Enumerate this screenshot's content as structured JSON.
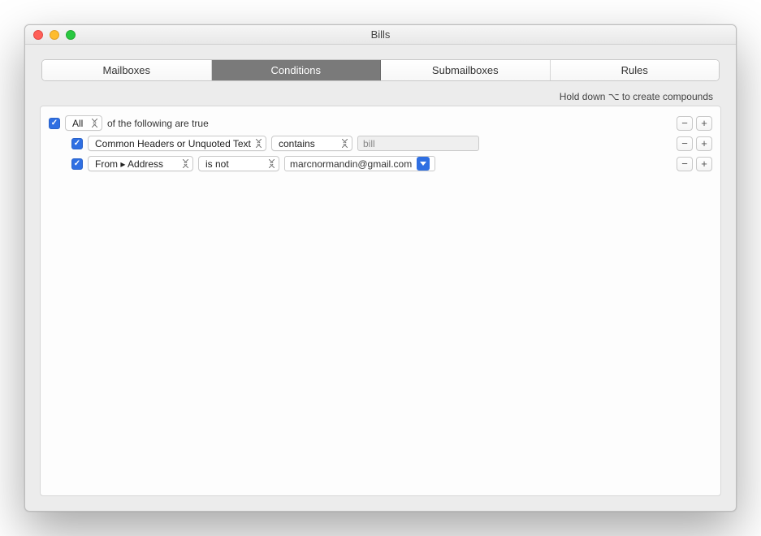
{
  "window": {
    "title": "Bills"
  },
  "tabs": {
    "mailboxes": "Mailboxes",
    "conditions": "Conditions",
    "submailboxes": "Submailboxes",
    "rules": "Rules",
    "active": "conditions"
  },
  "hint": "Hold down ⌥ to create compounds",
  "buttons": {
    "minus": "−",
    "plus": "+"
  },
  "root": {
    "quantifier": "All",
    "suffix": "of the following are true"
  },
  "rows": [
    {
      "field": "Common Headers or Unquoted Text",
      "op": "contains",
      "value": "bill",
      "value_disabled": true
    },
    {
      "field": "From ▸ Address",
      "op": "is not",
      "value": "marcnormandin@gmail.com",
      "is_token": true
    }
  ]
}
